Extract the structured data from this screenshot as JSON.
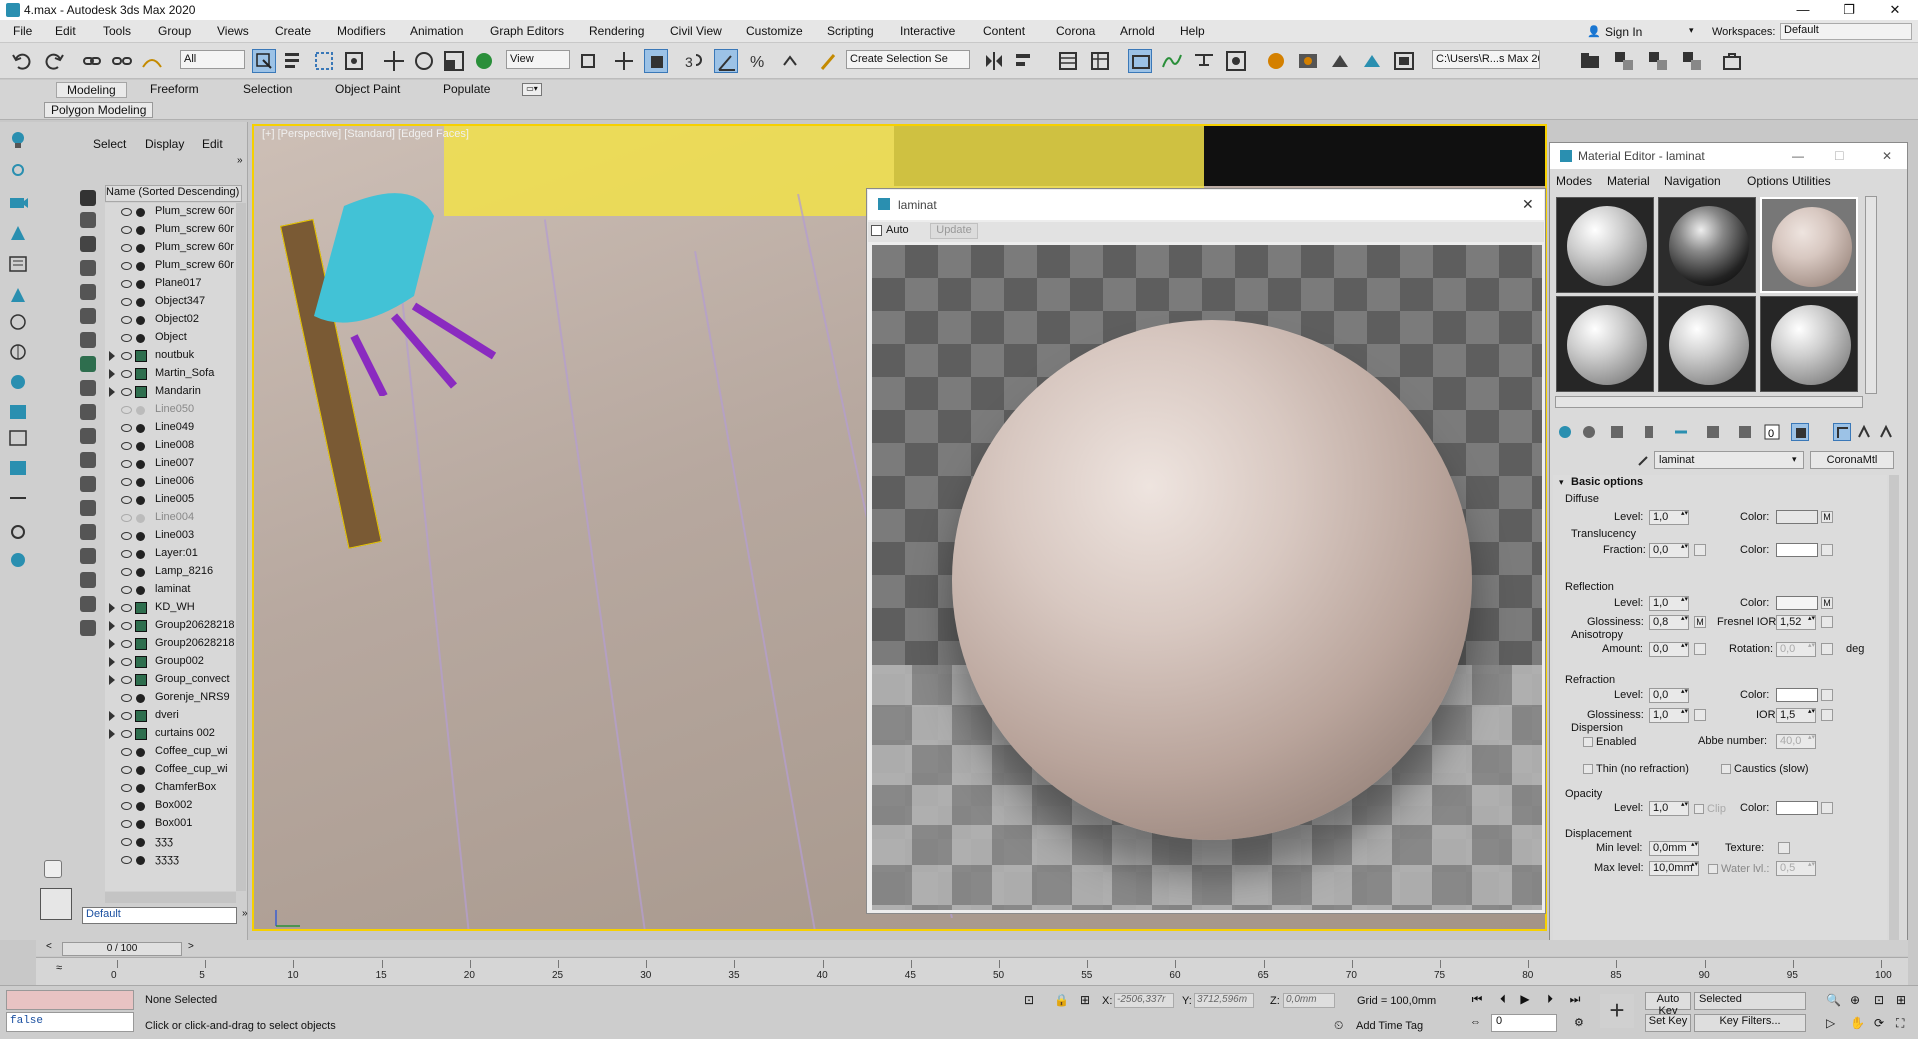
{
  "window": {
    "title": "4.max - Autodesk 3ds Max 2020",
    "min": "—",
    "max": "❐",
    "close": "✕"
  },
  "menu": [
    "File",
    "Edit",
    "Tools",
    "Group",
    "Views",
    "Create",
    "Modifiers",
    "Animation",
    "Graph Editors",
    "Rendering",
    "Civil View",
    "Customize",
    "Scripting",
    "Interactive",
    "Content",
    "Corona",
    "Arnold",
    "Help"
  ],
  "account": {
    "signin": "Sign In",
    "workspaces_label": "Workspaces:",
    "workspace": "Default"
  },
  "toolbar": {
    "filter": "All",
    "refsys": "View",
    "selset": "Create Selection Se",
    "path": "C:\\Users\\R...s Max 2020"
  },
  "ribbon": {
    "tabs": [
      "Modeling",
      "Freeform",
      "Selection",
      "Object Paint",
      "Populate"
    ],
    "panel": "Polygon Modeling"
  },
  "explorer": {
    "tabs": [
      "Select",
      "Display",
      "Edit"
    ],
    "header": "Name (Sorted Descending)",
    "layer": "Default",
    "items": [
      {
        "name": "Plum_screw 60r",
        "type": "obj"
      },
      {
        "name": "Plum_screw 60r",
        "type": "obj"
      },
      {
        "name": "Plum_screw 60r",
        "type": "obj"
      },
      {
        "name": "Plum_screw 60r",
        "type": "obj"
      },
      {
        "name": "Plane017",
        "type": "obj"
      },
      {
        "name": "Object347",
        "type": "obj"
      },
      {
        "name": "Object02",
        "type": "obj"
      },
      {
        "name": "Object",
        "type": "obj"
      },
      {
        "name": "noutbuk",
        "type": "group"
      },
      {
        "name": "Martin_Sofa",
        "type": "group"
      },
      {
        "name": "Mandarin",
        "type": "group"
      },
      {
        "name": "Line050",
        "type": "dim"
      },
      {
        "name": "Line049",
        "type": "obj"
      },
      {
        "name": "Line008",
        "type": "obj"
      },
      {
        "name": "Line007",
        "type": "obj"
      },
      {
        "name": "Line006",
        "type": "obj"
      },
      {
        "name": "Line005",
        "type": "obj"
      },
      {
        "name": "Line004",
        "type": "dim"
      },
      {
        "name": "Line003",
        "type": "obj"
      },
      {
        "name": "Layer:01",
        "type": "obj"
      },
      {
        "name": "Lamp_8216",
        "type": "obj"
      },
      {
        "name": "laminat",
        "type": "obj"
      },
      {
        "name": "KD_WH",
        "type": "group"
      },
      {
        "name": "Group20628218",
        "type": "group"
      },
      {
        "name": "Group20628218",
        "type": "group"
      },
      {
        "name": "Group002",
        "type": "group"
      },
      {
        "name": "Group_convect",
        "type": "group"
      },
      {
        "name": "Gorenje_NRS9",
        "type": "obj"
      },
      {
        "name": "dveri",
        "type": "group"
      },
      {
        "name": "curtains 002",
        "type": "group"
      },
      {
        "name": "Coffee_cup_wi",
        "type": "obj"
      },
      {
        "name": "Coffee_cup_wi",
        "type": "obj"
      },
      {
        "name": "ChamferBox",
        "type": "obj"
      },
      {
        "name": "Box002",
        "type": "obj"
      },
      {
        "name": "Box001",
        "type": "obj"
      },
      {
        "name": "ӡӡӡ",
        "type": "obj"
      },
      {
        "name": "ӡӡӡӡ",
        "type": "obj"
      }
    ]
  },
  "viewport": {
    "label": "[+] [Perspective] [Standard] [Edged Faces]"
  },
  "render_window": {
    "title": "laminat",
    "auto": "Auto",
    "update": "Update"
  },
  "material_editor": {
    "title": "Material Editor - laminat",
    "menus": [
      "Modes",
      "Material",
      "Navigation",
      "Options",
      "Utilities"
    ],
    "material_name": "laminat",
    "material_type": "CoronaMtl",
    "rollout": "Basic options",
    "diffuse": {
      "section": "Diffuse",
      "level_label": "Level:",
      "level": "1,0",
      "color_label": "Color:",
      "m": "M"
    },
    "translucency": {
      "section": "Translucency",
      "fraction_label": "Fraction:",
      "fraction": "0,0",
      "color_label": "Color:"
    },
    "reflection": {
      "section": "Reflection",
      "level_label": "Level:",
      "level": "1,0",
      "color_label": "Color:",
      "m": "M",
      "gloss_label": "Glossiness:",
      "gloss": "0,8",
      "fresnel_label": "Fresnel IOR:",
      "fresnel": "1,52",
      "aniso": "Anisotropy",
      "amount_label": "Amount:",
      "amount": "0,0",
      "rotation_label": "Rotation:",
      "rotation": "0,0",
      "deg": "deg"
    },
    "refraction": {
      "section": "Refraction",
      "level_label": "Level:",
      "level": "0,0",
      "color_label": "Color:",
      "gloss_label": "Glossiness:",
      "gloss": "1,0",
      "ior_label": "IOR:",
      "ior": "1,5",
      "dispersion": "Dispersion",
      "enabled": "Enabled",
      "abbe_label": "Abbe number:",
      "abbe": "40,0",
      "thin": "Thin (no refraction)",
      "caustics": "Caustics (slow)"
    },
    "opacity": {
      "section": "Opacity",
      "level_label": "Level:",
      "level": "1,0",
      "clip": "Clip",
      "color_label": "Color:"
    },
    "displacement": {
      "section": "Displacement",
      "min_label": "Min level:",
      "min": "0,0mm",
      "texture_label": "Texture:",
      "max_label": "Max level:",
      "max": "10,0mm",
      "water": "Water lvl.:",
      "water_val": "0,5"
    }
  },
  "timeline": {
    "slider": "0 / 100",
    "ticks": [
      "0",
      "5",
      "10",
      "15",
      "20",
      "25",
      "30",
      "35",
      "40",
      "45",
      "50",
      "55",
      "60",
      "65",
      "70",
      "75",
      "80",
      "85",
      "90",
      "95",
      "100"
    ]
  },
  "status": {
    "script_output": "false",
    "selection": "None Selected",
    "hint": "Click or click-and-drag to select objects",
    "x_label": "X:",
    "x": "-2506,337r",
    "y_label": "Y:",
    "y": "3712,596m",
    "z_label": "Z:",
    "z": "0,0mm",
    "grid": "Grid = 100,0mm",
    "add_time_tag": "Add Time Tag",
    "auto_key": "Auto Key",
    "set_key": "Set Key",
    "selected": "Selected",
    "key_filters": "Key Filters...",
    "frame": "0"
  },
  "colors": {
    "viewport_border": "#f6d000",
    "accent": "#3a78b8"
  }
}
